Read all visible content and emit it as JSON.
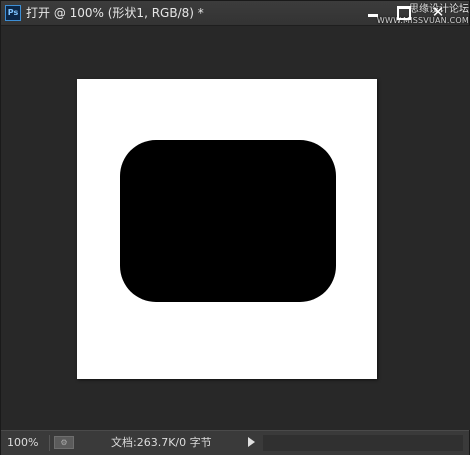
{
  "window": {
    "title": "打开 @ 100% (形状1, RGB/8) *",
    "app_badge": "Ps",
    "watermark": "思缘设计论坛",
    "watermark_url": "WWW.MISSVUAN.COM"
  },
  "controls": {
    "minimize_icon": "minimize-icon",
    "maximize_icon": "maximize-icon",
    "close_icon": "close-icon",
    "close_glyph": "✕"
  },
  "canvas": {
    "background_color": "#282828",
    "document_color": "#ffffff",
    "shape_color": "#000000",
    "shape_type": "rounded-rectangle"
  },
  "status": {
    "zoom": "100%",
    "doc_info": "文档:263.7K/0 字节"
  }
}
